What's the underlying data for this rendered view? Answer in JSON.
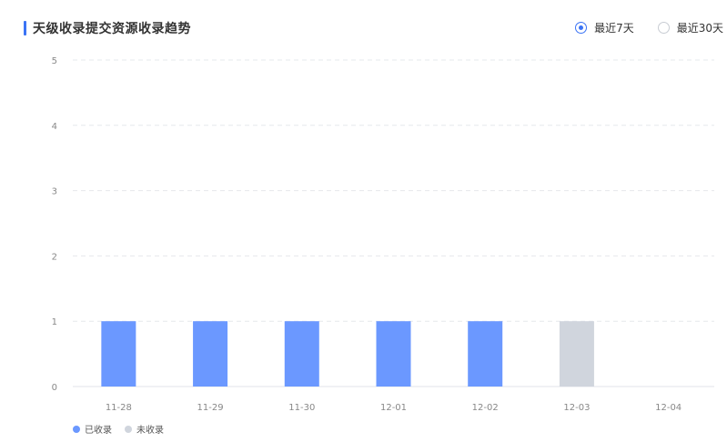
{
  "header": {
    "title": "天级收录提交资源收录趋势",
    "accent_color": "#3b73f5"
  },
  "range_options": [
    {
      "label": "最近7天",
      "selected": true
    },
    {
      "label": "最近30天",
      "selected": false
    }
  ],
  "chart_data": {
    "type": "bar",
    "title": "",
    "xlabel": "",
    "ylabel": "",
    "categories": [
      "11-28",
      "11-29",
      "11-30",
      "12-01",
      "12-02",
      "12-03",
      "12-04"
    ],
    "series": [
      {
        "name": "已收录",
        "color": "#6b98ff",
        "values": [
          1,
          1,
          1,
          1,
          1,
          0,
          0
        ]
      },
      {
        "name": "未收录",
        "color": "#d0d5dd",
        "values": [
          0,
          0,
          0,
          0,
          0,
          1,
          0
        ]
      }
    ],
    "stacked": true,
    "ylim": [
      0,
      5
    ],
    "yticks": [
      0,
      1,
      2,
      3,
      4,
      5
    ],
    "grid": true,
    "legend_position": "bottom-left"
  }
}
